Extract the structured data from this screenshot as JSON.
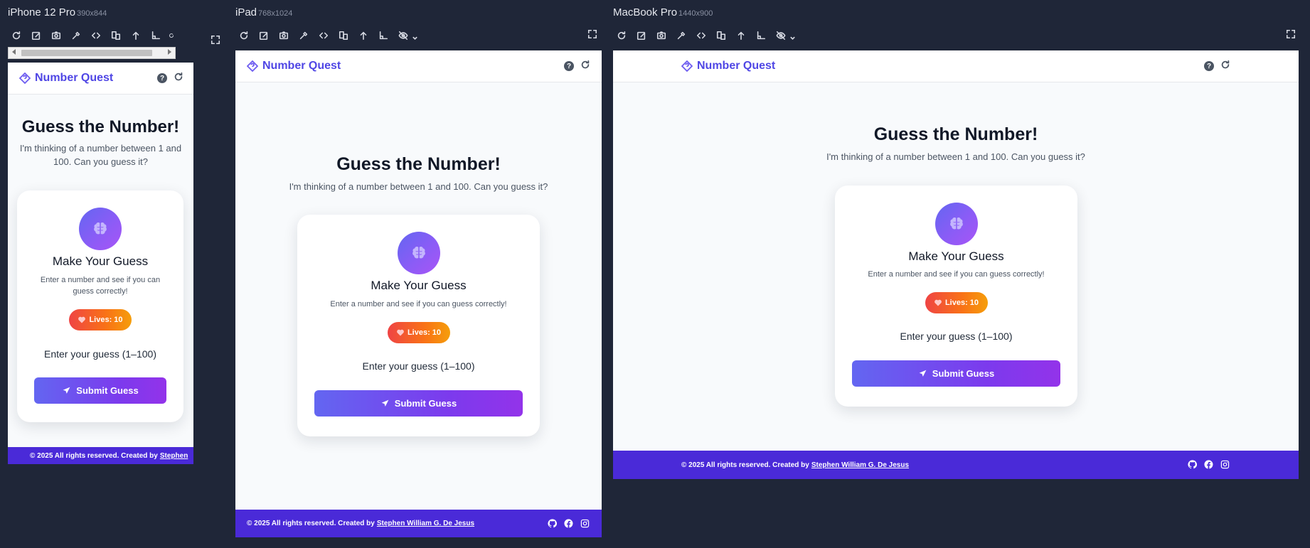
{
  "devices": [
    {
      "name": "iPhone 12 Pro",
      "dims": "390x844"
    },
    {
      "name": "iPad",
      "dims": "768x1024"
    },
    {
      "name": "MacBook Pro",
      "dims": "1440x900"
    }
  ],
  "app": {
    "brand": "Number Quest",
    "title": "Guess the Number!",
    "subtitle": "I'm thinking of a number between 1 and 100. Can you guess it?",
    "subtitle_mobile_line1": "I'm thinking of a number between 1 and",
    "subtitle_mobile_line2": "100. Can you guess it?",
    "card_title": "Make Your Guess",
    "card_desc": "Enter a number and see if you can guess correctly!",
    "card_desc_mobile_line1": "Enter a number and see if you can",
    "card_desc_mobile_line2": "guess correctly!",
    "lives": "Lives: 10",
    "prompt": "Enter your guess (1–100)",
    "submit": "Submit Guess",
    "footer_text": "© 2025 All rights reserved. Created by",
    "footer_author": "Stephen William G. De Jesus",
    "footer_author_short": "Stephen"
  },
  "icons": {
    "toolbar": [
      "refresh-icon",
      "edit-screenshot-icon",
      "camera-icon",
      "eyedropper-icon",
      "code-icon",
      "layout-icon",
      "arrow-up-icon",
      "ruler-icon",
      "eye-off-icon"
    ],
    "socials": [
      "github-icon",
      "facebook-icon",
      "instagram-icon"
    ]
  },
  "colors": {
    "background": "#1f2638",
    "brand": "#4f46e5",
    "footer": "#4a2ad8",
    "accent_gradient": [
      "#6366f1",
      "#9333ea"
    ],
    "lives_gradient": [
      "#ef4444",
      "#f59e0b"
    ]
  }
}
